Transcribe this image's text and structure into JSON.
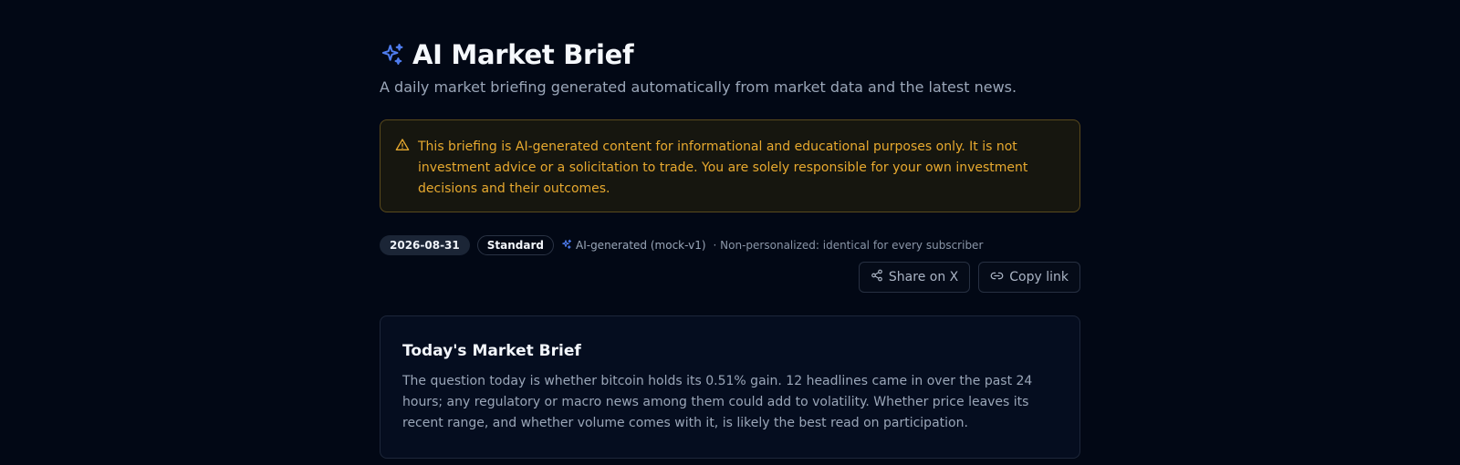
{
  "header": {
    "title": "AI Market Brief",
    "subtitle": "A daily market briefing generated automatically from market data and the latest news.",
    "title_icon": "sparkles-icon"
  },
  "disclaimer": {
    "icon": "warning-triangle-icon",
    "text": "This briefing is AI-generated content for informational and educational purposes only. It is not investment advice or a solicitation to trade. You are solely responsible for your own investment decisions and their outcomes."
  },
  "meta": {
    "date": "2026-08-31",
    "tier": "Standard",
    "ai_generated": "AI-generated (mock-v1)",
    "personalization": "· Non-personalized: identical for every subscriber"
  },
  "actions": {
    "share_label": "Share on X",
    "copy_label": "Copy link"
  },
  "brief": {
    "title": "Today's Market Brief",
    "body": "The question today is whether bitcoin holds its 0.51% gain. 12 headlines came in over the past 24 hours; any regulatory or macro news among them could add to volatility. Whether price leaves its recent range, and whether volume comes with it, is likely the best read on participation."
  },
  "colors": {
    "background": "#020815",
    "accent": "#4f7df0",
    "warning": "#e7a92f"
  }
}
